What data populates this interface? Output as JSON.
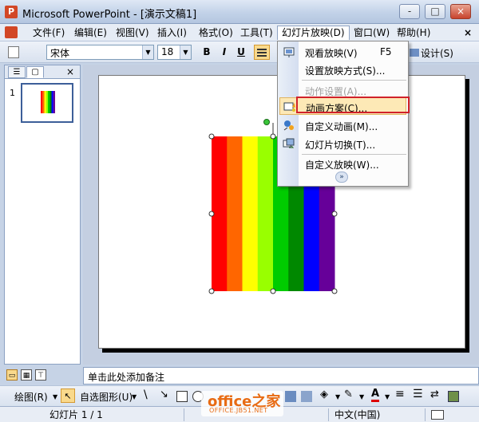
{
  "window": {
    "title": "Microsoft PowerPoint - [演示文稿1]",
    "buttons": [
      "-",
      "□",
      "×"
    ]
  },
  "menubar": {
    "items": [
      "文件(F)",
      "编辑(E)",
      "视图(V)",
      "插入(I)",
      "格式(O)",
      "工具(T)",
      "幻灯片放映(D)",
      "窗口(W)",
      "帮助(H)"
    ],
    "active_index": 6,
    "doc_close": "×"
  },
  "toolbar": {
    "font": "宋体",
    "size": "18",
    "bold": "B",
    "italic": "I",
    "underline": "U",
    "design": "设计(S)"
  },
  "slides_pane": {
    "slide_number": "1"
  },
  "notes": {
    "placeholder": "单击此处添加备注"
  },
  "slide_show_menu": {
    "items": [
      {
        "label": "观看放映(V)",
        "shortcut": "F5",
        "enabled": true,
        "icon": "slideshow-icon"
      },
      {
        "label": "设置放映方式(S)...",
        "enabled": true,
        "icon": ""
      },
      {
        "label": "动作设置(A)...",
        "enabled": false,
        "icon": ""
      },
      {
        "label": "动画方案(C)...",
        "enabled": true,
        "highlighted": true,
        "icon": "animation-scheme-icon"
      },
      {
        "label": "自定义动画(M)...",
        "enabled": true,
        "icon": "custom-animation-icon"
      },
      {
        "label": "幻灯片切换(T)...",
        "enabled": true,
        "icon": "slide-transition-icon"
      },
      {
        "label": "自定义放映(W)...",
        "enabled": true,
        "icon": ""
      }
    ],
    "more": "»"
  },
  "drawing_toolbar": {
    "draw": "绘图(R)",
    "autoshapes": "自选图形(U)"
  },
  "statusbar": {
    "slide": "幻灯片 1 / 1",
    "language": "中文(中国)"
  },
  "rainbow": {
    "stripes": [
      "#ff0000",
      "#ff6600",
      "#ffff00",
      "#99ff00",
      "#00cc00",
      "#008800",
      "#0000ff",
      "#660099"
    ]
  },
  "watermark": {
    "main": "office之家",
    "sub": "OFFICE.JB51.NET"
  }
}
